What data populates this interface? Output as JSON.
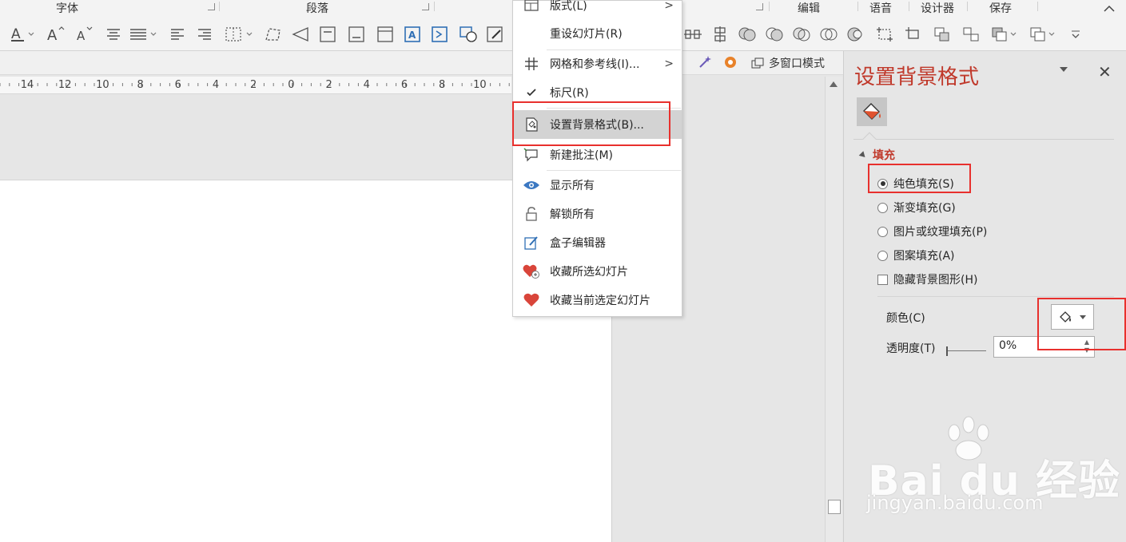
{
  "ribbon": {
    "groups": [
      "字体",
      "段落",
      "编辑",
      "语音",
      "设计器",
      "保存"
    ]
  },
  "subbar": {
    "multi_window_label": "多窗口模式"
  },
  "ruler": {
    "labels": [
      "14",
      "12",
      "10",
      "8",
      "6",
      "4",
      "2",
      "0",
      "2",
      "4",
      "6",
      "8",
      "10"
    ]
  },
  "context_menu": {
    "items": [
      {
        "label": "版式(L)",
        "icon": "layout-icon",
        "submenu": true
      },
      {
        "label": "重设幻灯片(R)",
        "icon": "",
        "submenu": false
      },
      {
        "label": "网格和参考线(I)...",
        "icon": "grid-icon",
        "submenu": true
      },
      {
        "label": "标尺(R)",
        "icon": "check-icon",
        "submenu": false
      },
      {
        "label": "设置背景格式(B)...",
        "icon": "format-background-icon",
        "submenu": false,
        "highlighted": true
      },
      {
        "label": "新建批注(M)",
        "icon": "new-comment-icon",
        "submenu": false
      },
      {
        "label": "显示所有",
        "icon": "eye-icon",
        "submenu": false
      },
      {
        "label": "解锁所有",
        "icon": "unlock-icon",
        "submenu": false
      },
      {
        "label": "盒子编辑器",
        "icon": "edit-box-icon",
        "submenu": false
      },
      {
        "label": "收藏所选幻灯片",
        "icon": "heart-add-icon",
        "submenu": false
      },
      {
        "label": "收藏当前选定幻灯片",
        "icon": "heart-icon",
        "submenu": false
      }
    ]
  },
  "pane": {
    "title": "设置背景格式",
    "section": "填充",
    "options": [
      {
        "label": "纯色填充(S)",
        "type": "radio",
        "checked": true
      },
      {
        "label": "渐变填充(G)",
        "type": "radio",
        "checked": false
      },
      {
        "label": "图片或纹理填充(P)",
        "type": "radio",
        "checked": false
      },
      {
        "label": "图案填充(A)",
        "type": "radio",
        "checked": false
      },
      {
        "label": "隐藏背景图形(H)",
        "type": "checkbox",
        "checked": false
      }
    ],
    "color_label": "颜色(C)",
    "transparency_label": "透明度(T)",
    "transparency_value": "0%"
  },
  "watermark": {
    "text": "Bai du 经验",
    "url": "jingyan.baidu.com"
  },
  "colors": {
    "accent": "#c0392b",
    "highlight_box": "#e8302d"
  }
}
